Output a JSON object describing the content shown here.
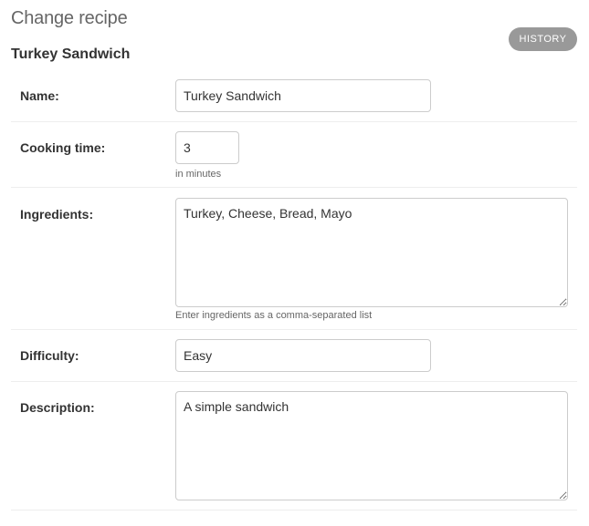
{
  "header": {
    "title": "Change recipe",
    "history_label": "HISTORY",
    "object_title": "Turkey Sandwich"
  },
  "form": {
    "name": {
      "label": "Name:",
      "value": "Turkey Sandwich"
    },
    "cooking_time": {
      "label": "Cooking time:",
      "value": "3",
      "help": "in minutes"
    },
    "ingredients": {
      "label": "Ingredients:",
      "value": "Turkey, Cheese, Bread, Mayo",
      "help": "Enter ingredients as a comma-separated list"
    },
    "difficulty": {
      "label": "Difficulty:",
      "value": "Easy"
    },
    "description": {
      "label": "Description:",
      "value": "A simple sandwich"
    }
  }
}
